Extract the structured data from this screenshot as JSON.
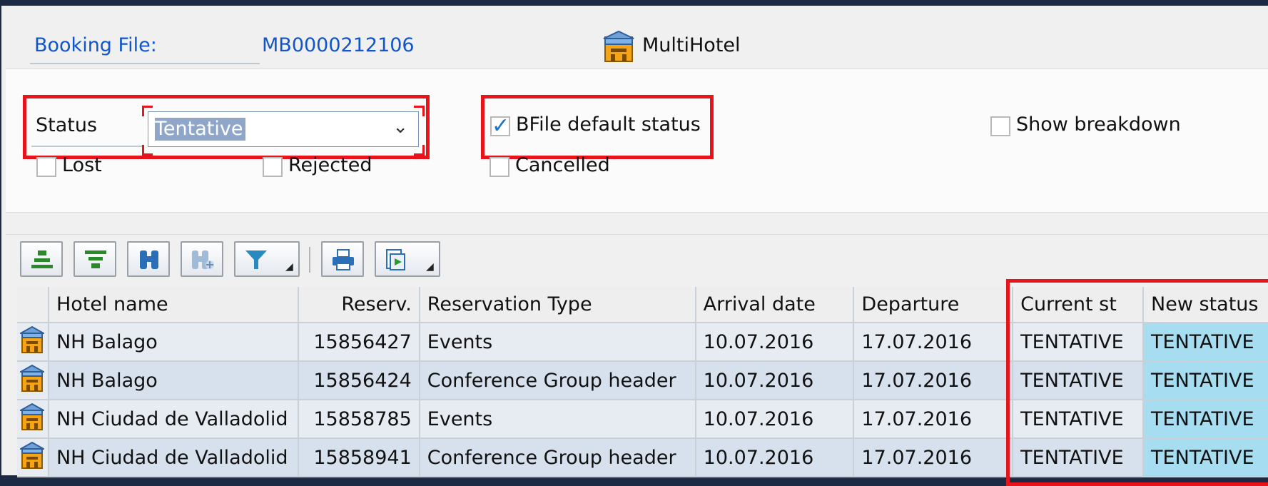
{
  "header": {
    "booking_file_label": "Booking File:",
    "booking_file_value": "MB0000212106",
    "app_icon": "hotel-icon",
    "app_name": "MultiHotel"
  },
  "filters": {
    "status_label": "Status",
    "status_value": "Tentative",
    "bfile_default_label": "BFile default status",
    "bfile_default_checked": true,
    "show_breakdown_label": "Show breakdown",
    "show_breakdown_checked": false,
    "lost_label": "Lost",
    "rejected_label": "Rejected",
    "cancelled_label": "Cancelled"
  },
  "toolbar": {
    "buttons": [
      "align-top-icon",
      "filter-rows-icon",
      "find-icon",
      "find-next-icon",
      "filter-icon",
      "print-icon",
      "export-icon"
    ]
  },
  "table": {
    "columns": [
      "",
      "Hotel name",
      "Reserv.",
      "Reservation Type",
      "Arrival date",
      "Departure",
      "Current st",
      "New status"
    ],
    "rows": [
      {
        "hotel": "NH Balago",
        "reserv": "15856427",
        "type": "Events",
        "arrival": "10.07.2016",
        "departure": "17.07.2016",
        "current": "TENTATIVE",
        "new": "TENTATIVE"
      },
      {
        "hotel": "NH Balago",
        "reserv": "15856424",
        "type": "Conference Group header",
        "arrival": "10.07.2016",
        "departure": "17.07.2016",
        "current": "TENTATIVE",
        "new": "TENTATIVE"
      },
      {
        "hotel": "NH Ciudad de Valladolid",
        "reserv": "15858785",
        "type": "Events",
        "arrival": "10.07.2016",
        "departure": "17.07.2016",
        "current": "TENTATIVE",
        "new": "TENTATIVE"
      },
      {
        "hotel": "NH Ciudad de Valladolid",
        "reserv": "15858941",
        "type": "Conference Group header",
        "arrival": "10.07.2016",
        "departure": "17.07.2016",
        "current": "TENTATIVE",
        "new": "TENTATIVE"
      }
    ]
  },
  "colors": {
    "highlight_box": "#e8141b",
    "new_status_cell": "#a6ddf0",
    "link_blue": "#1155cc"
  }
}
